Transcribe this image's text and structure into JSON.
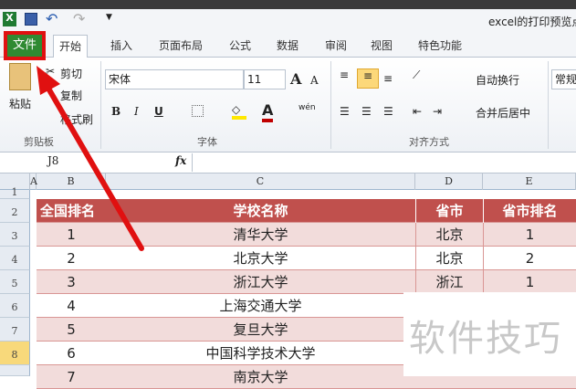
{
  "window": {
    "title": "excel的打印预览点"
  },
  "quick_access": {
    "excel": "X",
    "save": "save",
    "undo": "undo",
    "redo": "redo",
    "customize": "▼"
  },
  "tabs": [
    {
      "label": "文件"
    },
    {
      "label": "开始"
    },
    {
      "label": "插入"
    },
    {
      "label": "页面布局"
    },
    {
      "label": "公式"
    },
    {
      "label": "数据"
    },
    {
      "label": "审阅"
    },
    {
      "label": "视图"
    },
    {
      "label": "特色功能"
    }
  ],
  "ribbon": {
    "clipboard": {
      "paste": "粘贴",
      "cut": "剪切",
      "copy": "复制",
      "format_painter": "格式刷",
      "label": "剪贴板"
    },
    "font": {
      "name": "宋体",
      "size": "11",
      "grow": "A",
      "shrink": "A",
      "bold": "B",
      "italic": "I",
      "underline": "U",
      "font_color": "A",
      "phonetic": "wén",
      "label": "字体"
    },
    "alignment": {
      "wrap": "自动换行",
      "merge": "合并后居中",
      "label": "对齐方式"
    },
    "number": {
      "format": "常规"
    }
  },
  "formula_bar": {
    "name_box": "J8",
    "fx": "fx",
    "value": ""
  },
  "columns": [
    "A",
    "B",
    "C",
    "D",
    "E"
  ],
  "row_numbers": [
    "1",
    "2",
    "3",
    "4",
    "5",
    "6",
    "7",
    "8"
  ],
  "table": {
    "headers": [
      "全国排名",
      "学校名称",
      "省市",
      "省市排名"
    ],
    "rows": [
      [
        "1",
        "清华大学",
        "北京",
        "1"
      ],
      [
        "2",
        "北京大学",
        "北京",
        "2"
      ],
      [
        "3",
        "浙江大学",
        "浙江",
        "1"
      ],
      [
        "4",
        "上海交通大学",
        "",
        ""
      ],
      [
        "5",
        "复旦大学",
        "",
        ""
      ],
      [
        "6",
        "中国科学技术大学",
        "",
        ""
      ],
      [
        "7",
        "南京大学",
        "",
        ""
      ]
    ]
  },
  "watermark": "软件技巧",
  "colors": {
    "header_red": "#c0504d",
    "band_pink": "#f2dcdb",
    "file_green": "#2f8a32",
    "highlight_red": "#e01010"
  }
}
